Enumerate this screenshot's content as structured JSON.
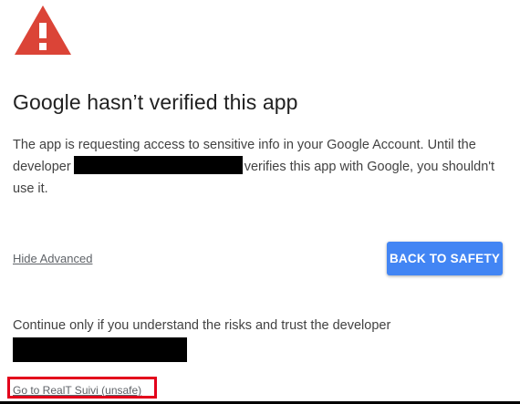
{
  "icons": {
    "warning": "warning-icon",
    "warning_color": "#db4437"
  },
  "title": "Google hasn’t verified this app",
  "description": {
    "part1": "The app is requesting access to sensitive info in your Google Account. Until the developer",
    "part2": "verifies this app with Google, you shouldn't use it."
  },
  "links": {
    "hide_advanced": "Hide Advanced",
    "go_unsafe": "Go to RealT Suivi (unsafe)"
  },
  "buttons": {
    "back_to_safety": "BACK TO SAFETY"
  },
  "continue_text": "Continue only if you understand the risks and trust the developer",
  "colors": {
    "primary_button": "#4285f4",
    "highlight_box": "#e3001b"
  }
}
